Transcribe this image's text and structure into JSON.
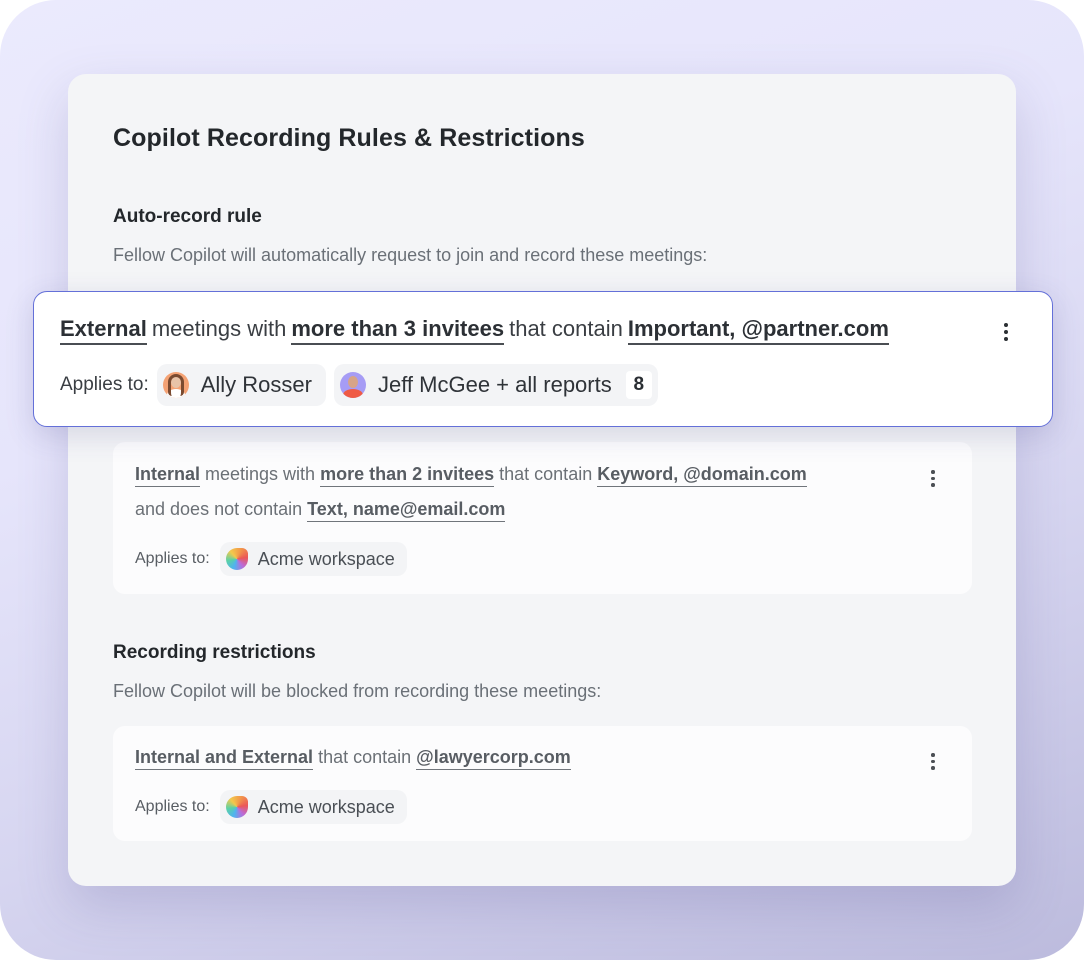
{
  "page": {
    "title": "Copilot Recording Rules & Restrictions"
  },
  "auto_record": {
    "heading": "Auto-record rule",
    "description": "Fellow Copilot will automatically request to join and record these meetings:",
    "rules": [
      {
        "segments": [
          {
            "type": "keyword",
            "text": "External"
          },
          {
            "type": "plain",
            "text": "meetings with"
          },
          {
            "type": "keyword",
            "text": "more than 3 invitees"
          },
          {
            "type": "plain",
            "text": "that contain"
          },
          {
            "type": "keyword",
            "text": "Important, @partner.com"
          }
        ],
        "applies_label": "Applies to:",
        "targets": [
          {
            "kind": "user",
            "name": "Ally Rosser",
            "avatar_color": "#f4a274"
          },
          {
            "kind": "user",
            "name": "Jeff McGee + all reports",
            "avatar_color": "#a69cf5",
            "count": "8"
          }
        ],
        "highlighted": true,
        "menu_icon": "more-vertical-icon"
      },
      {
        "segments_line1": [
          {
            "type": "keyword",
            "text": "Internal"
          },
          {
            "type": "plain",
            "text": "meetings with"
          },
          {
            "type": "keyword",
            "text": "more than 2 invitees"
          },
          {
            "type": "plain",
            "text": "that contain"
          },
          {
            "type": "keyword",
            "text": "Keyword, @domain.com"
          }
        ],
        "segments_line2": [
          {
            "type": "plain",
            "text": "and does not contain"
          },
          {
            "type": "keyword",
            "text": "Text, name@email.com"
          }
        ],
        "applies_label": "Applies to:",
        "targets": [
          {
            "kind": "workspace",
            "name": "Acme workspace"
          }
        ],
        "highlighted": false,
        "menu_icon": "more-vertical-icon"
      }
    ]
  },
  "restrictions": {
    "heading": "Recording restrictions",
    "description": "Fellow Copilot will be blocked from recording these meetings:",
    "rules": [
      {
        "segments": [
          {
            "type": "keyword",
            "text": "Internal and External"
          },
          {
            "type": "plain",
            "text": "that contain"
          },
          {
            "type": "keyword",
            "text": "@lawyercorp.com"
          }
        ],
        "applies_label": "Applies to:",
        "targets": [
          {
            "kind": "workspace",
            "name": "Acme workspace"
          }
        ],
        "menu_icon": "more-vertical-icon"
      }
    ]
  },
  "colors": {
    "accent_border": "#6470d8",
    "panel_bg": "#f4f5f7",
    "text_dark": "#23272b",
    "text_muted": "#6a7077"
  }
}
